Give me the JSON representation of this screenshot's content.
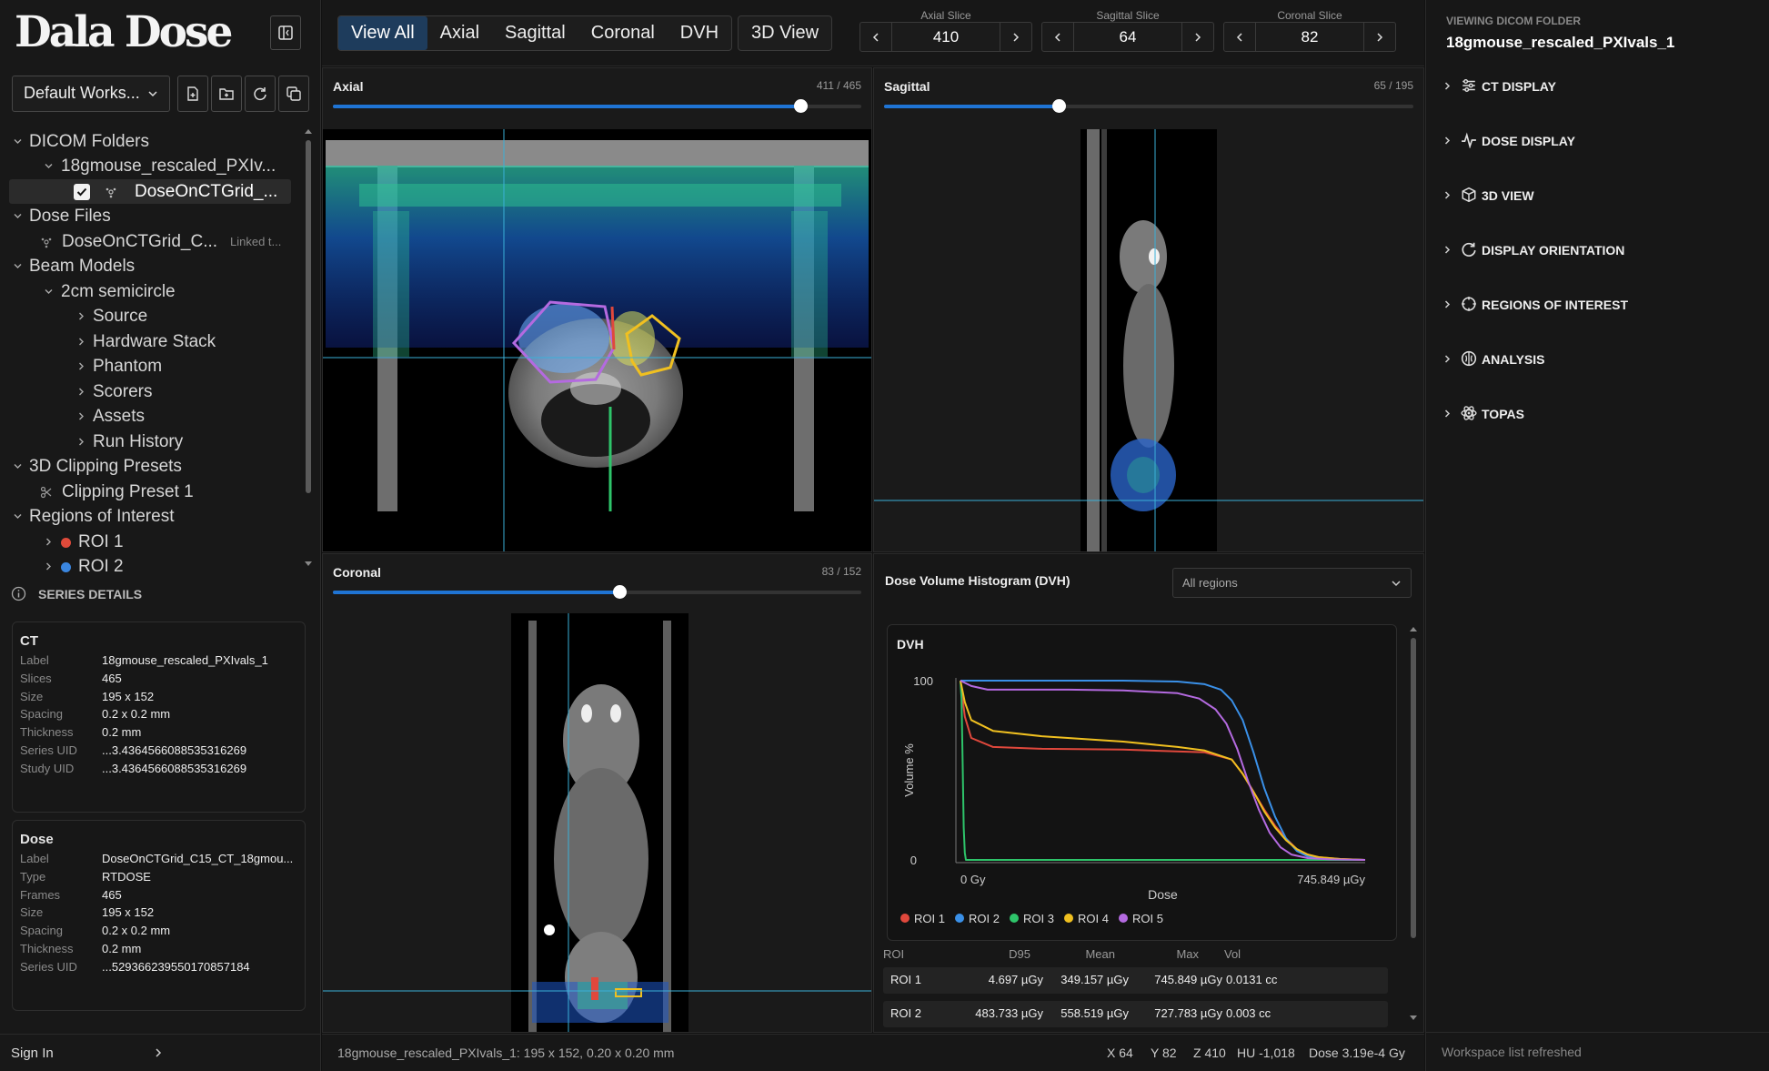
{
  "app": {
    "logo": "Dala Dose"
  },
  "workspace": {
    "selected": "Default Works..."
  },
  "tree": {
    "dicom_folders": "DICOM Folders",
    "folder": "18gmouse_rescaled_PXIv...",
    "dose_item": "DoseOnCTGrid_...",
    "dose_files": "Dose Files",
    "dose_file": "DoseOnCTGrid_C...",
    "dose_file_status": "Linked t...",
    "beam_models": "Beam Models",
    "beam_model": "2cm semicircle",
    "source": "Source",
    "hardware": "Hardware Stack",
    "phantom": "Phantom",
    "scorers": "Scorers",
    "assets": "Assets",
    "run_history": "Run History",
    "clip_presets": "3D Clipping Presets",
    "clip_preset": "Clipping Preset 1",
    "rois": "Regions of Interest",
    "roi1": "ROI 1",
    "roi2": "ROI 2",
    "roi1_color": "#e04a3a",
    "roi2_color": "#3a86e0"
  },
  "series": {
    "header": "SERIES DETAILS",
    "ct": {
      "title": "CT",
      "rows": [
        {
          "k": "Label",
          "v": "18gmouse_rescaled_PXIvals_1"
        },
        {
          "k": "Slices",
          "v": "465"
        },
        {
          "k": "Size",
          "v": "195 x 152"
        },
        {
          "k": "Spacing",
          "v": "0.2 x 0.2 mm"
        },
        {
          "k": "Thickness",
          "v": "0.2 mm"
        },
        {
          "k": "Series UID",
          "v": "...3.4364566088535316269"
        },
        {
          "k": "Study UID",
          "v": "...3.4364566088535316269"
        }
      ]
    },
    "dose": {
      "title": "Dose",
      "rows": [
        {
          "k": "Label",
          "v": "DoseOnCTGrid_C15_CT_18gmou..."
        },
        {
          "k": "Type",
          "v": "RTDOSE"
        },
        {
          "k": "Frames",
          "v": "465"
        },
        {
          "k": "Size",
          "v": "195 x 152"
        },
        {
          "k": "Spacing",
          "v": "0.2 x 0.2 mm"
        },
        {
          "k": "Thickness",
          "v": "0.2 mm"
        },
        {
          "k": "Series UID",
          "v": "...5293662395501708571​84"
        }
      ]
    }
  },
  "signin": "Sign In",
  "tabs": [
    "View All",
    "Axial",
    "Sagittal",
    "Coronal",
    "DVH"
  ],
  "tab3d": "3D View",
  "slicers": {
    "axial": {
      "label": "Axial Slice",
      "value": "410"
    },
    "sagittal": {
      "label": "Sagittal Slice",
      "value": "64"
    },
    "coronal": {
      "label": "Coronal Slice",
      "value": "82"
    }
  },
  "views": {
    "axial": {
      "title": "Axial",
      "counter": "411 / 465",
      "progress": 0.884
    },
    "sagittal": {
      "title": "Sagittal",
      "counter": "65 / 195",
      "progress": 0.33
    },
    "coronal": {
      "title": "Coronal",
      "counter": "83 / 152",
      "progress": 0.543
    }
  },
  "dvh": {
    "panel_title": "Dose Volume Histogram (DVH)",
    "filter": "All regions",
    "table_headers": [
      "ROI",
      "D95",
      "Mean",
      "Max",
      "Vol"
    ],
    "table_rows": [
      {
        "roi": "ROI 1",
        "d95": "4.697 µGy",
        "mean": "349.157 µGy",
        "max": "745.849 µGy",
        "vol": "0.0131 cc"
      },
      {
        "roi": "ROI 2",
        "d95": "483.733 µGy",
        "mean": "558.519 µGy",
        "max": "727.783 µGy",
        "vol": "0.003 cc"
      }
    ]
  },
  "chart_data": {
    "type": "line",
    "title": "DVH",
    "xlabel": "Dose",
    "ylabel": "Volume %",
    "x_tick_labels": [
      "0 Gy",
      "745.849 µGy"
    ],
    "y_tick_labels": [
      "100",
      "0"
    ],
    "xlim": [
      0,
      745.849
    ],
    "ylim": [
      0,
      100
    ],
    "x_unit": "µGy",
    "legend_position": "bottom",
    "grid": false,
    "series": [
      {
        "name": "ROI 1",
        "color": "#e0483c",
        "x": [
          0,
          8,
          20,
          60,
          150,
          300,
          450,
          500,
          520,
          540,
          560,
          580,
          600,
          620,
          640,
          660,
          700,
          745.849
        ],
        "y": [
          100,
          80,
          68,
          63,
          62,
          61.5,
          60,
          56,
          48,
          38,
          28,
          19,
          12,
          6,
          3,
          1.5,
          0.5,
          0
        ]
      },
      {
        "name": "ROI 2",
        "color": "#3a90e8",
        "x": [
          0,
          100,
          200,
          300,
          400,
          450,
          480,
          500,
          520,
          540,
          560,
          580,
          600,
          620,
          640,
          660,
          700,
          745.849
        ],
        "y": [
          100,
          100,
          100,
          100,
          99.5,
          98,
          95,
          89,
          78,
          60,
          40,
          24,
          12,
          5,
          2,
          1,
          0.3,
          0
        ]
      },
      {
        "name": "ROI 3",
        "color": "#2ec46a",
        "x": [
          0,
          2,
          4,
          6,
          8,
          10,
          745.849
        ],
        "y": [
          100,
          90,
          55,
          18,
          4,
          0,
          0
        ]
      },
      {
        "name": "ROI 4",
        "color": "#f0c020",
        "x": [
          0,
          8,
          20,
          60,
          150,
          300,
          400,
          450,
          500,
          520,
          540,
          560,
          580,
          600,
          620,
          640,
          660,
          700,
          745.849
        ],
        "y": [
          100,
          88,
          78,
          72,
          69,
          66,
          63,
          61,
          56,
          48,
          38,
          27,
          18,
          11,
          6,
          3,
          1.5,
          0.5,
          0
        ]
      },
      {
        "name": "ROI 5",
        "color": "#b46ae0",
        "x": [
          0,
          20,
          50,
          100,
          200,
          300,
          400,
          440,
          470,
          490,
          510,
          530,
          550,
          570,
          590,
          610,
          640,
          680,
          745.849
        ],
        "y": [
          100,
          97,
          95,
          95,
          95,
          94.5,
          93,
          90,
          84,
          76,
          62,
          44,
          28,
          15,
          7,
          3,
          1,
          0.3,
          0
        ]
      }
    ]
  },
  "right": {
    "label": "VIEWING DICOM FOLDER",
    "name": "18gmouse_rescaled_PXIvals_1",
    "sections": [
      "CT DISPLAY",
      "DOSE DISPLAY",
      "3D VIEW",
      "DISPLAY ORIENTATION",
      "REGIONS OF INTEREST",
      "ANALYSIS",
      "TOPAS"
    ],
    "status": "Workspace list refreshed"
  },
  "statusbar": {
    "left": "18gmouse_rescaled_PXIvals_1: 195 x 152, 0.20 x 0.20 mm",
    "x": "X 64",
    "y": "Y 82",
    "z": "Z 410",
    "hu": "HU -1,018",
    "dose": "Dose 3.19e-4 Gy"
  }
}
